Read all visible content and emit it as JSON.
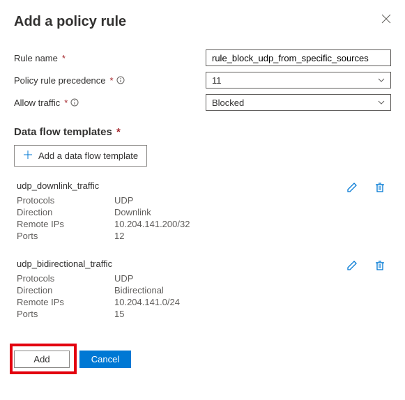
{
  "title": "Add a policy rule",
  "labels": {
    "rule_name": "Rule name",
    "precedence": "Policy rule precedence",
    "allow_traffic": "Allow traffic",
    "data_flow_templates": "Data flow templates",
    "add_template": "Add a data flow template"
  },
  "fields": {
    "rule_name_value": "rule_block_udp_from_specific_sources",
    "precedence_value": "11",
    "allow_traffic_value": "Blocked"
  },
  "kv_labels": {
    "protocols": "Protocols",
    "direction": "Direction",
    "remote_ips": "Remote IPs",
    "ports": "Ports"
  },
  "templates": [
    {
      "name": "udp_downlink_traffic",
      "protocols": "UDP",
      "direction": "Downlink",
      "remote_ips": "10.204.141.200/32",
      "ports": "12"
    },
    {
      "name": "udp_bidirectional_traffic",
      "protocols": "UDP",
      "direction": "Bidirectional",
      "remote_ips": "10.204.141.0/24",
      "ports": "15"
    }
  ],
  "buttons": {
    "add": "Add",
    "cancel": "Cancel"
  }
}
